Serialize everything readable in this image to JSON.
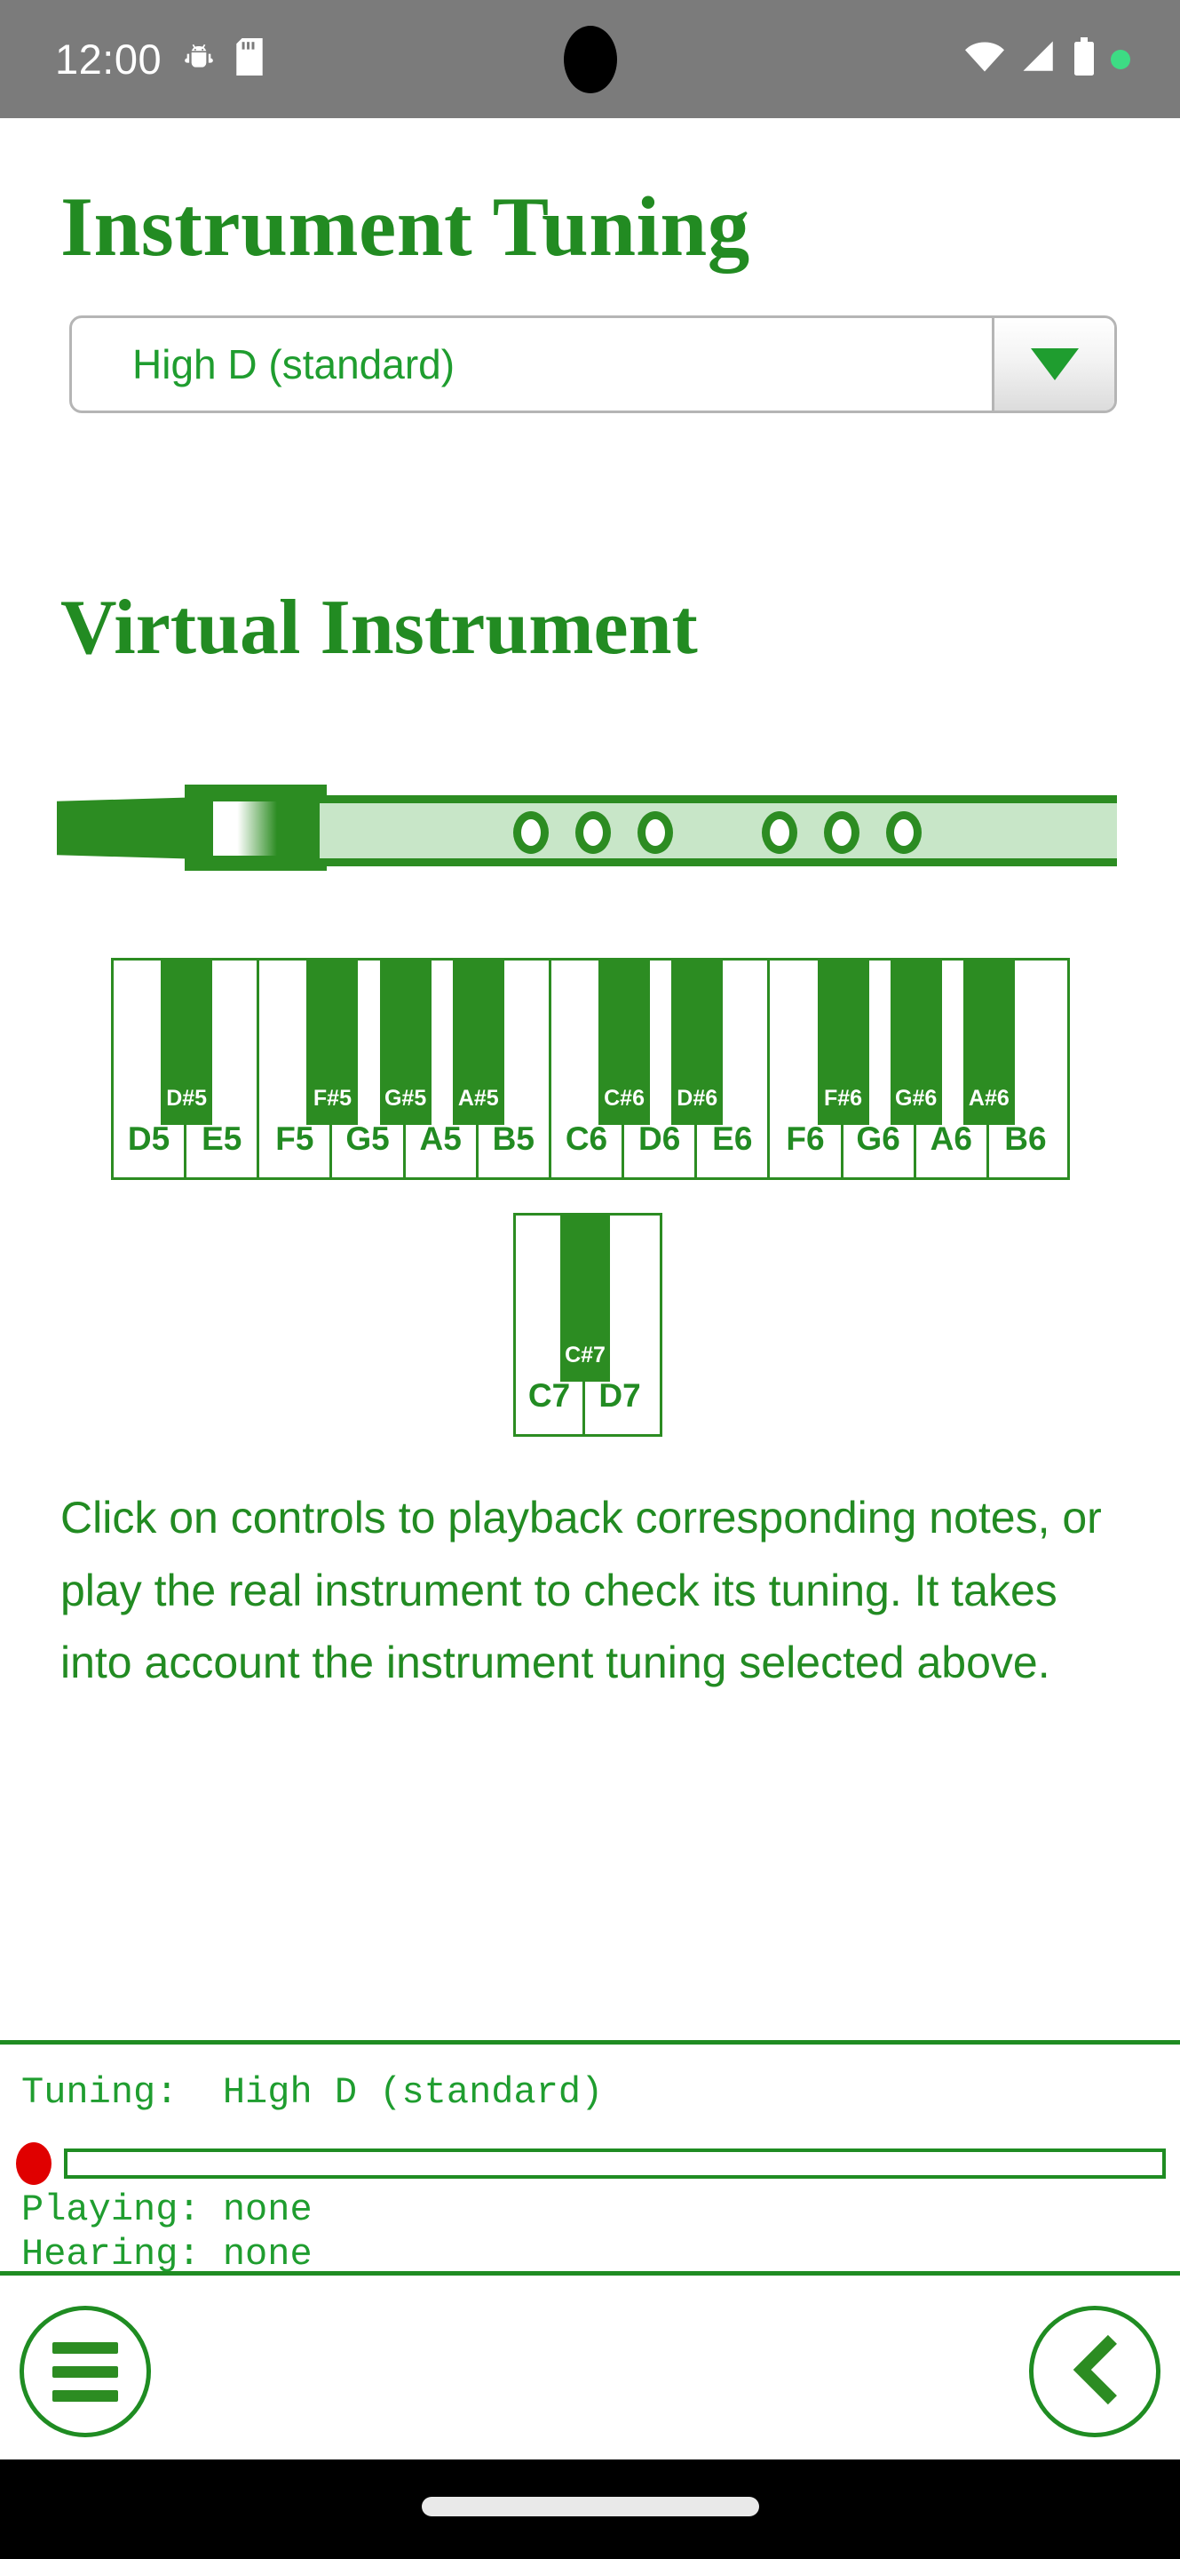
{
  "status_bar": {
    "time": "12:00",
    "left_icons": [
      "android-bug-icon",
      "sd-card-icon"
    ],
    "right_icons": [
      "wifi-icon",
      "cell-signal-icon",
      "battery-icon",
      "green-dot-indicator"
    ]
  },
  "header": {
    "page_title": "Instrument Tuning"
  },
  "tuning_select": {
    "value": "High D (standard)",
    "arrow": "chevron-down-icon"
  },
  "section": {
    "title": "Virtual Instrument"
  },
  "whistle": {
    "name": "tin-whistle-graphic",
    "hole_count": 6,
    "hole_groups": [
      3,
      3
    ]
  },
  "keyboard_main": {
    "white_keys": [
      "D5",
      "E5",
      "F5",
      "G5",
      "A5",
      "B5",
      "C6",
      "D6",
      "E6",
      "F6",
      "G6",
      "A6",
      "B6"
    ],
    "black_keys": [
      {
        "label": "D#5",
        "after": "D5"
      },
      {
        "label": "F#5",
        "after": "F5"
      },
      {
        "label": "G#5",
        "after": "G5"
      },
      {
        "label": "A#5",
        "after": "A5"
      },
      {
        "label": "C#6",
        "after": "C6"
      },
      {
        "label": "D#6",
        "after": "D6"
      },
      {
        "label": "F#6",
        "after": "F6"
      },
      {
        "label": "G#6",
        "after": "G6"
      },
      {
        "label": "A#6",
        "after": "A6"
      }
    ]
  },
  "keyboard_ext": {
    "white_keys": [
      "C7",
      "D7"
    ],
    "black_keys": [
      {
        "label": "C#7",
        "after": "C7"
      }
    ]
  },
  "description": {
    "text": "Click on controls to playback corresponding notes, or play the real instrument to check its tuning. It takes into account the instrument tuning selected above."
  },
  "status_footer": {
    "tuning_line": "Tuning:  High D (standard)",
    "playing_line": "Playing: none",
    "hearing_line": "Hearing: none",
    "record_indicator": "record-dot",
    "level_value": 0
  },
  "bottom_nav": {
    "menu_label": "hamburger-menu-icon",
    "back_label": "back-chevron-icon"
  },
  "colors": {
    "green": "#228b22",
    "green_dark": "#2c8c22",
    "green_light": "#c8e6c8",
    "accent_text": "#1f9d2f",
    "record_red": "#e00000",
    "status_bar_bg": "#7b7b7b"
  }
}
